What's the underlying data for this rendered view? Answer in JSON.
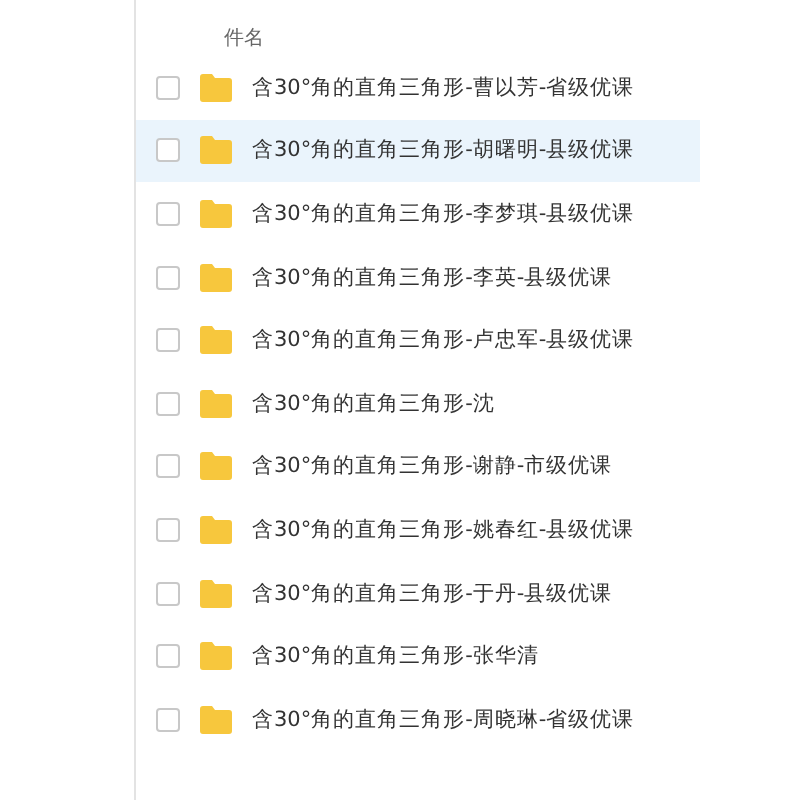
{
  "header": {
    "column_label": "件名"
  },
  "files": [
    {
      "name": "含30°角的直角三角形-曹以芳-省级优课",
      "selected": false
    },
    {
      "name": "含30°角的直角三角形-胡曙明-县级优课",
      "selected": true
    },
    {
      "name": "含30°角的直角三角形-李梦琪-县级优课",
      "selected": false
    },
    {
      "name": "含30°角的直角三角形-李英-县级优课",
      "selected": false
    },
    {
      "name": "含30°角的直角三角形-卢忠军-县级优课",
      "selected": false
    },
    {
      "name": "含30°角的直角三角形-沈",
      "selected": false
    },
    {
      "name": "含30°角的直角三角形-谢静-市级优课",
      "selected": false
    },
    {
      "name": "含30°角的直角三角形-姚春红-县级优课",
      "selected": false
    },
    {
      "name": "含30°角的直角三角形-于丹-县级优课",
      "selected": false
    },
    {
      "name": "含30°角的直角三角形-张华清",
      "selected": false
    },
    {
      "name": "含30°角的直角三角形-周晓琳-省级优课",
      "selected": false
    }
  ]
}
